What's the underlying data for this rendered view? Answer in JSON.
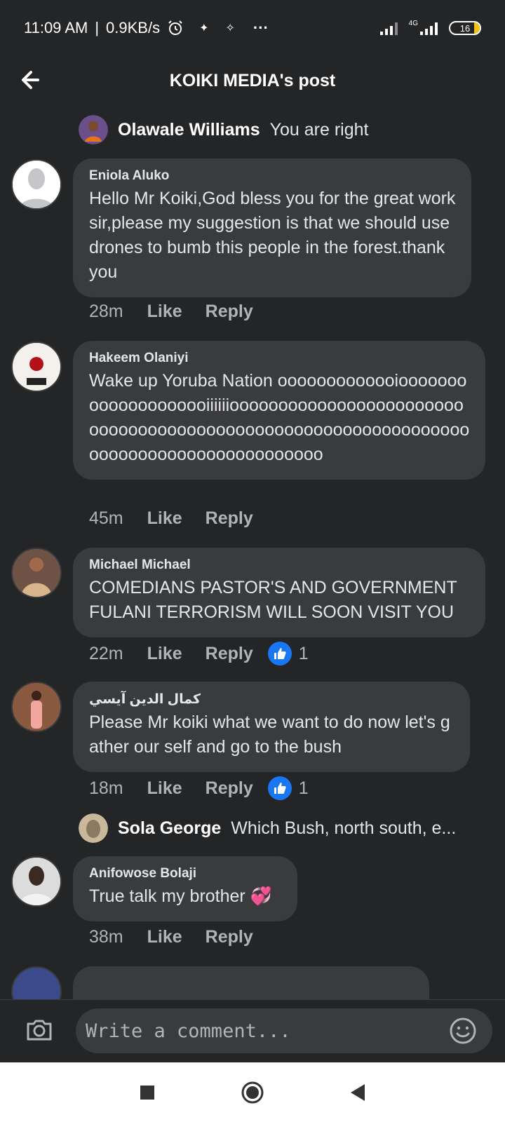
{
  "status_bar": {
    "time": "11:09 AM",
    "speed": "0.9KB/s",
    "more": "···",
    "network": "4G",
    "battery": "16"
  },
  "header": {
    "title": "KOIKI MEDIA's post"
  },
  "comments": [
    {
      "type": "reply_preview",
      "name": "Olawale Williams",
      "text": "You are right"
    },
    {
      "type": "comment",
      "name": "Eniola Aluko",
      "text": "Hello Mr Koiki,God bless you for the great work sir,please my suggestion is that we should use drones to bumb this people in the forest.thank you",
      "time": "28m",
      "like_label": "Like",
      "reply_label": "Reply"
    },
    {
      "type": "comment",
      "name": "Hakeem Olaniyi",
      "text": "Wake up Yoruba Nation ooooooooooooioooooooooooooooooooiiiiiiooooooooooooooooooooooooooooooooooooooooooooooooooooooooooooooooooooooooooooooooooooooo",
      "time": "45m",
      "like_label": "Like",
      "reply_label": "Reply"
    },
    {
      "type": "comment",
      "name": "Michael Michael",
      "text": "COMEDIANS PASTOR'S AND GOVERNMENT FULANI TERRORISM WILL SOON VISIT YOU",
      "time": "22m",
      "like_label": "Like",
      "reply_label": "Reply",
      "reactions": "1"
    },
    {
      "type": "comment",
      "name": "كمال الدين آيسي",
      "text": "Please Mr koiki what we want to do now let's gather our self and go to the bush",
      "time": "18m",
      "like_label": "Like",
      "reply_label": "Reply",
      "reactions": "1"
    },
    {
      "type": "reply_preview",
      "name": "Sola George",
      "text": "Which Bush, north south, e..."
    },
    {
      "type": "comment",
      "name": "Anifowose Bolaji",
      "text": "True talk my brother 💞",
      "time": "38m",
      "like_label": "Like",
      "reply_label": "Reply"
    }
  ],
  "composer": {
    "placeholder": "Write a comment..."
  },
  "colors": {
    "background": "#242526",
    "bubble": "#3a3b3c",
    "text": "#e4e6eb",
    "secondary_text": "#b0b3b8",
    "like_blue": "#1877f2"
  },
  "icons": [
    "back-arrow-icon",
    "alarm-icon",
    "signal-icon",
    "battery-icon",
    "camera-icon",
    "emoji-icon",
    "like-thumb-icon",
    "nav-recents-icon",
    "nav-home-icon",
    "nav-back-icon"
  ]
}
